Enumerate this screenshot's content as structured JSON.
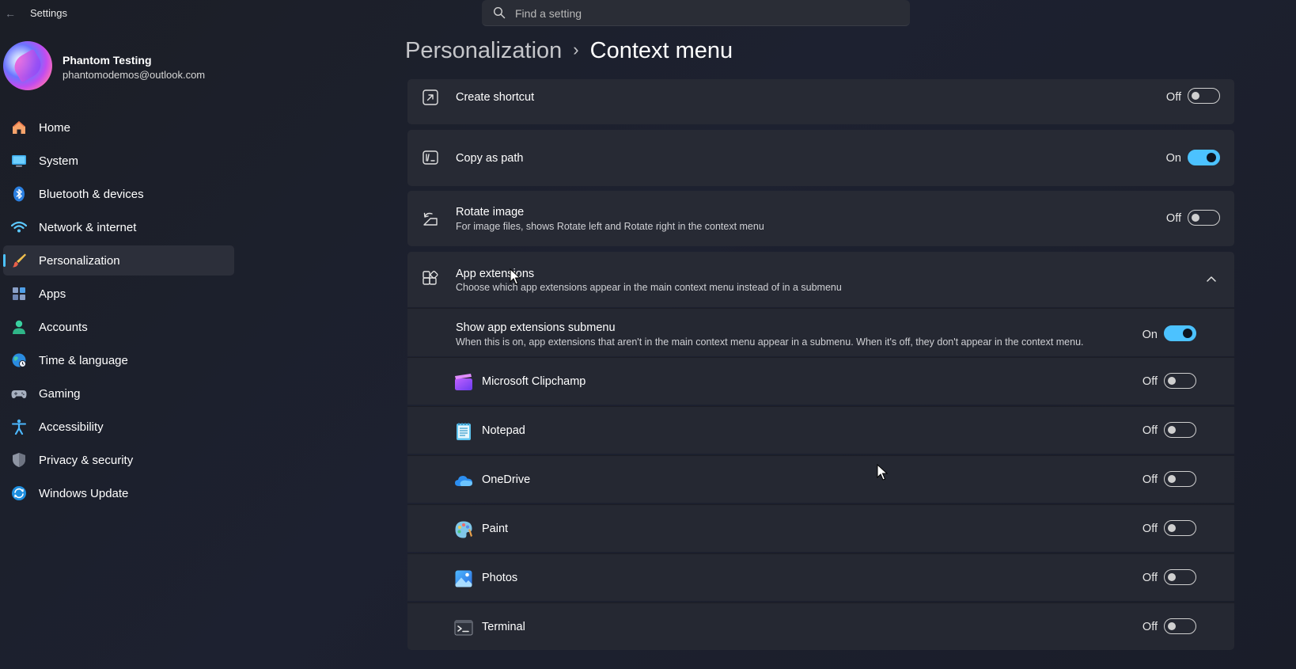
{
  "window": {
    "title": "Settings"
  },
  "search": {
    "placeholder": "Find a setting"
  },
  "profile": {
    "name": "Phantom Testing",
    "email": "phantomodemos@outlook.com"
  },
  "nav": {
    "items": [
      {
        "label": "Home",
        "icon": "home-icon"
      },
      {
        "label": "System",
        "icon": "monitor-icon"
      },
      {
        "label": "Bluetooth & devices",
        "icon": "bluetooth-icon"
      },
      {
        "label": "Network & internet",
        "icon": "wifi-icon"
      },
      {
        "label": "Personalization",
        "icon": "brush-icon",
        "active": true
      },
      {
        "label": "Apps",
        "icon": "apps-icon"
      },
      {
        "label": "Accounts",
        "icon": "person-icon"
      },
      {
        "label": "Time & language",
        "icon": "globe-icon"
      },
      {
        "label": "Gaming",
        "icon": "gamepad-icon"
      },
      {
        "label": "Accessibility",
        "icon": "accessibility-icon"
      },
      {
        "label": "Privacy & security",
        "icon": "shield-icon"
      },
      {
        "label": "Windows Update",
        "icon": "update-icon"
      }
    ]
  },
  "breadcrumb": {
    "parent": "Personalization",
    "separator": "›",
    "current": "Context menu"
  },
  "settings": {
    "create_shortcut": {
      "title": "Create shortcut",
      "state": "Off"
    },
    "copy_as_path": {
      "title": "Copy as path",
      "state": "On"
    },
    "rotate_image": {
      "title": "Rotate image",
      "description": "For image files, shows Rotate left and Rotate right in the context menu",
      "state": "Off"
    },
    "app_extensions": {
      "title": "App extensions",
      "description": "Choose which app extensions appear in the main context menu instead of in a submenu"
    },
    "show_submenu": {
      "title": "Show app extensions submenu",
      "description": "When this is on, app extensions that aren't in the main context menu appear in a submenu. When it's off, they don't appear in the context menu.",
      "state": "On"
    },
    "extensions": [
      {
        "label": "Microsoft Clipchamp",
        "state": "Off",
        "icon": "clipchamp-icon"
      },
      {
        "label": "Notepad",
        "state": "Off",
        "icon": "notepad-icon"
      },
      {
        "label": "OneDrive",
        "state": "Off",
        "icon": "onedrive-icon"
      },
      {
        "label": "Paint",
        "state": "Off",
        "icon": "paint-icon"
      },
      {
        "label": "Photos",
        "state": "Off",
        "icon": "photos-icon"
      },
      {
        "label": "Terminal",
        "state": "Off",
        "icon": "terminal-icon"
      }
    ]
  },
  "colors": {
    "accent": "#4cc2ff",
    "card": "#272a34",
    "background": "#1d2130"
  }
}
